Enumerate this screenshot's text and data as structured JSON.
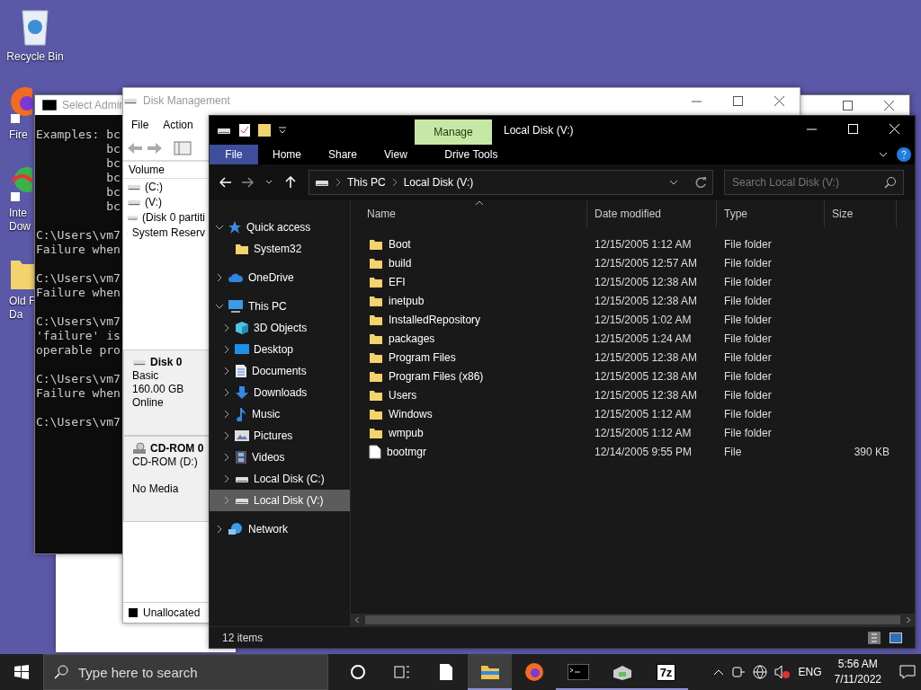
{
  "desktop_icons": [
    {
      "kind": "recycle",
      "lines": [
        "Recycle Bin"
      ]
    },
    {
      "kind": "firefox",
      "lines": [
        "Fire"
      ]
    },
    {
      "kind": "download",
      "lines": [
        "Inte",
        "Dow"
      ]
    },
    {
      "kind": "folder",
      "lines": [
        "Old F",
        "Da"
      ]
    }
  ],
  "cmd_window": {
    "title": "Select Admin",
    "blocks": [
      [
        "Examples: bc",
        "          bc",
        "          bc",
        "          bc",
        "          bc",
        "          bc"
      ],
      [
        "C:\\Users\\vm7",
        "Failure when"
      ],
      [
        "C:\\Users\\vm7",
        "Failure when"
      ],
      [
        "C:\\Users\\vm7",
        "'failure' is",
        "operable pro"
      ],
      [
        "C:\\Users\\vm7",
        "Failure when"
      ],
      [
        "C:\\Users\\vm7"
      ]
    ]
  },
  "disk_management": {
    "title": "Disk Management",
    "menu": [
      "File",
      "Action"
    ],
    "volume_header": "Volume",
    "volumes": [
      "(C:)",
      "(V:)",
      "(Disk 0 partiti",
      "System Reserv"
    ],
    "disks": [
      {
        "kind": "disk",
        "name": "Disk 0",
        "lines": [
          "Basic",
          "160.00 GB",
          "Online"
        ]
      },
      {
        "kind": "cdrom",
        "name": "CD-ROM 0",
        "lines": [
          "CD-ROM (D:)"
        ],
        "status": "No Media"
      }
    ],
    "legend": "Unallocated"
  },
  "explorer": {
    "context_tab": "Manage",
    "title": "Local Disk (V:)",
    "ribbon_tabs": [
      {
        "label": "File",
        "kind": "file"
      },
      {
        "label": "Home",
        "kind": "tab"
      },
      {
        "label": "Share",
        "kind": "tab"
      },
      {
        "label": "View",
        "kind": "tab"
      },
      {
        "label": "Drive Tools",
        "kind": "context"
      }
    ],
    "breadcrumb": [
      "This PC",
      "Local Disk (V:)"
    ],
    "search": {
      "placeholder": "Search Local Disk (V:)"
    },
    "nav": [
      {
        "label": "Quick access",
        "kind": "star",
        "expanded": true,
        "selected": false,
        "children": [
          {
            "label": "System32",
            "kind": "folder",
            "selected": false
          }
        ]
      },
      {
        "label": "OneDrive",
        "kind": "cloud",
        "expanded": false,
        "selected": false
      },
      {
        "label": "This PC",
        "kind": "pc",
        "expanded": true,
        "selected": false,
        "children": [
          {
            "label": "3D Objects",
            "kind": "cube",
            "expanded": false,
            "selected": false
          },
          {
            "label": "Desktop",
            "kind": "desktop",
            "expanded": false,
            "selected": false
          },
          {
            "label": "Documents",
            "kind": "document",
            "expanded": false,
            "selected": false
          },
          {
            "label": "Downloads",
            "kind": "download",
            "expanded": false,
            "selected": false
          },
          {
            "label": "Music",
            "kind": "music",
            "expanded": false,
            "selected": false
          },
          {
            "label": "Pictures",
            "kind": "pictures",
            "expanded": false,
            "selected": false
          },
          {
            "label": "Videos",
            "kind": "videos",
            "expanded": false,
            "selected": false
          },
          {
            "label": "Local Disk (C:)",
            "kind": "drive",
            "expanded": false,
            "selected": false
          },
          {
            "label": "Local Disk (V:)",
            "kind": "drive",
            "expanded": false,
            "selected": true
          }
        ]
      },
      {
        "label": "Network",
        "kind": "network",
        "expanded": false,
        "selected": false
      }
    ],
    "columns": [
      "Name",
      "Date modified",
      "Type",
      "Size"
    ],
    "files": [
      {
        "kind": "folder",
        "name": "Boot",
        "date": "12/15/2005 1:12 AM",
        "type": "File folder"
      },
      {
        "kind": "folder",
        "name": "build",
        "date": "12/15/2005 12:57 AM",
        "type": "File folder"
      },
      {
        "kind": "folder",
        "name": "EFI",
        "date": "12/15/2005 12:38 AM",
        "type": "File folder"
      },
      {
        "kind": "folder",
        "name": "inetpub",
        "date": "12/15/2005 12:38 AM",
        "type": "File folder"
      },
      {
        "kind": "folder",
        "name": "InstalledRepository",
        "date": "12/15/2005 1:02 AM",
        "type": "File folder"
      },
      {
        "kind": "folder",
        "name": "packages",
        "date": "12/15/2005 1:24 AM",
        "type": "File folder"
      },
      {
        "kind": "folder",
        "name": "Program Files",
        "date": "12/15/2005 12:38 AM",
        "type": "File folder"
      },
      {
        "kind": "folder",
        "name": "Program Files (x86)",
        "date": "12/15/2005 12:38 AM",
        "type": "File folder"
      },
      {
        "kind": "folder",
        "name": "Users",
        "date": "12/15/2005 12:38 AM",
        "type": "File folder"
      },
      {
        "kind": "folder",
        "name": "Windows",
        "date": "12/15/2005 1:12 AM",
        "type": "File folder"
      },
      {
        "kind": "folder",
        "name": "wmpub",
        "date": "12/15/2005 1:12 AM",
        "type": "File folder"
      },
      {
        "kind": "file",
        "name": "bootmgr",
        "date": "12/14/2005 9:55 PM",
        "type": "File",
        "size": "390 KB"
      }
    ],
    "status": "12 items"
  },
  "taskbar": {
    "search": {
      "placeholder": "Type here to search"
    },
    "apps": [
      {
        "kind": "cortana",
        "selected": false,
        "running": false
      },
      {
        "kind": "taskview",
        "selected": false,
        "running": false
      },
      {
        "kind": "notepad",
        "selected": false,
        "running": false
      },
      {
        "kind": "explorer",
        "selected": true,
        "running": true
      },
      {
        "kind": "firefox",
        "selected": false,
        "running": false
      },
      {
        "kind": "cmd",
        "selected": false,
        "running": true
      },
      {
        "kind": "diskmgmt",
        "selected": false,
        "running": true
      },
      {
        "kind": "sevenzip",
        "selected": false,
        "running": true,
        "label": "7z"
      }
    ],
    "language": "ENG",
    "time": "5:56 AM",
    "date": "7/11/2022"
  }
}
